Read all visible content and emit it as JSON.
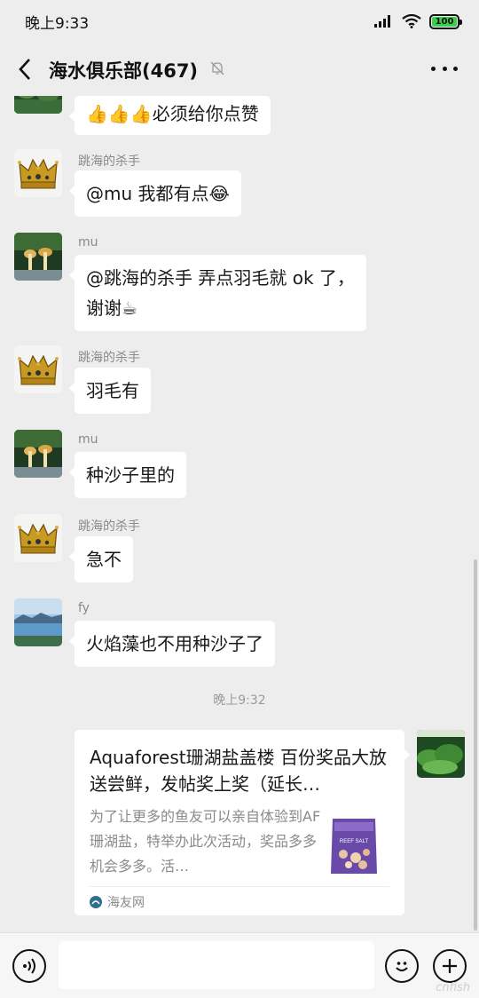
{
  "status_bar": {
    "time": "晚上9:33",
    "battery": "100",
    "battery_level": 1.0
  },
  "header": {
    "title": "海水俱乐部(467)"
  },
  "messages": [
    {
      "sender": "",
      "text": "必须给你点赞",
      "emoji_prefix": "👍👍👍"
    },
    {
      "sender": "跳海的杀手",
      "text": "@mu  我都有点😂"
    },
    {
      "sender": "mu",
      "text": "@跳海的杀手  弄点羽毛就 ok 了，",
      "text2": "谢谢☕"
    },
    {
      "sender": "跳海的杀手",
      "text": "羽毛有"
    },
    {
      "sender": "mu",
      "text": "种沙子里的"
    },
    {
      "sender": "跳海的杀手",
      "text": "急不"
    },
    {
      "sender": "fy",
      "text": "火焰藻也不用种沙子了"
    }
  ],
  "timestamp": "晚上9:32",
  "link_card": {
    "title": "Aquaforest珊湖盐盖楼 百份奖品大放送尝鲜，发帖奖上奖（延长…",
    "description": "为了让更多的鱼友可以亲自体验到AF珊湖盐，特举办此次活动，奖品多多机会多多。活…",
    "source": "海友网",
    "thumb_label": "REEF SALT"
  },
  "input": {
    "placeholder": ""
  },
  "watermark": "cnfish"
}
